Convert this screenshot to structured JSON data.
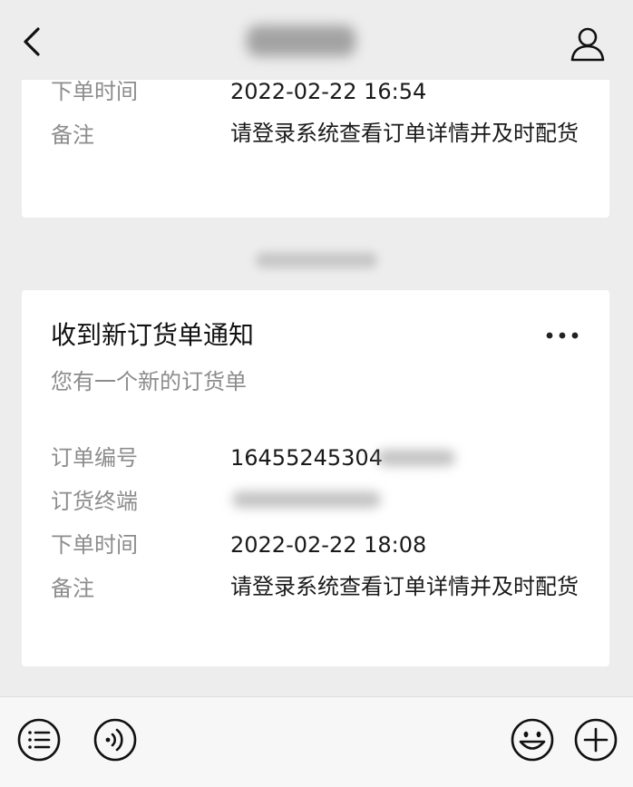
{
  "header": {
    "title": "",
    "back_icon": "chevron-left-icon",
    "profile_icon": "person-icon"
  },
  "card_top": {
    "rows": [
      {
        "label": "下单时间",
        "value": "2022-02-22 16:54"
      },
      {
        "label": "备注",
        "value": "请登录系统查看订单详情并及时配货"
      }
    ]
  },
  "timestamp": "",
  "card_main": {
    "title": "收到新订货单通知",
    "desc": "您有一个新的订货单",
    "more_icon": "more-dots-icon",
    "rows": [
      {
        "label": "订单编号",
        "value": "16455245304"
      },
      {
        "label": "订货终端",
        "value": ""
      },
      {
        "label": "下单时间",
        "value": "2022-02-22 18:08"
      },
      {
        "label": "备注",
        "value": "请登录系统查看订单详情并及时配货"
      }
    ]
  },
  "bottom_bar": {
    "icons": [
      "menu-list-icon",
      "voice-icon",
      "emoji-icon",
      "plus-icon"
    ]
  }
}
